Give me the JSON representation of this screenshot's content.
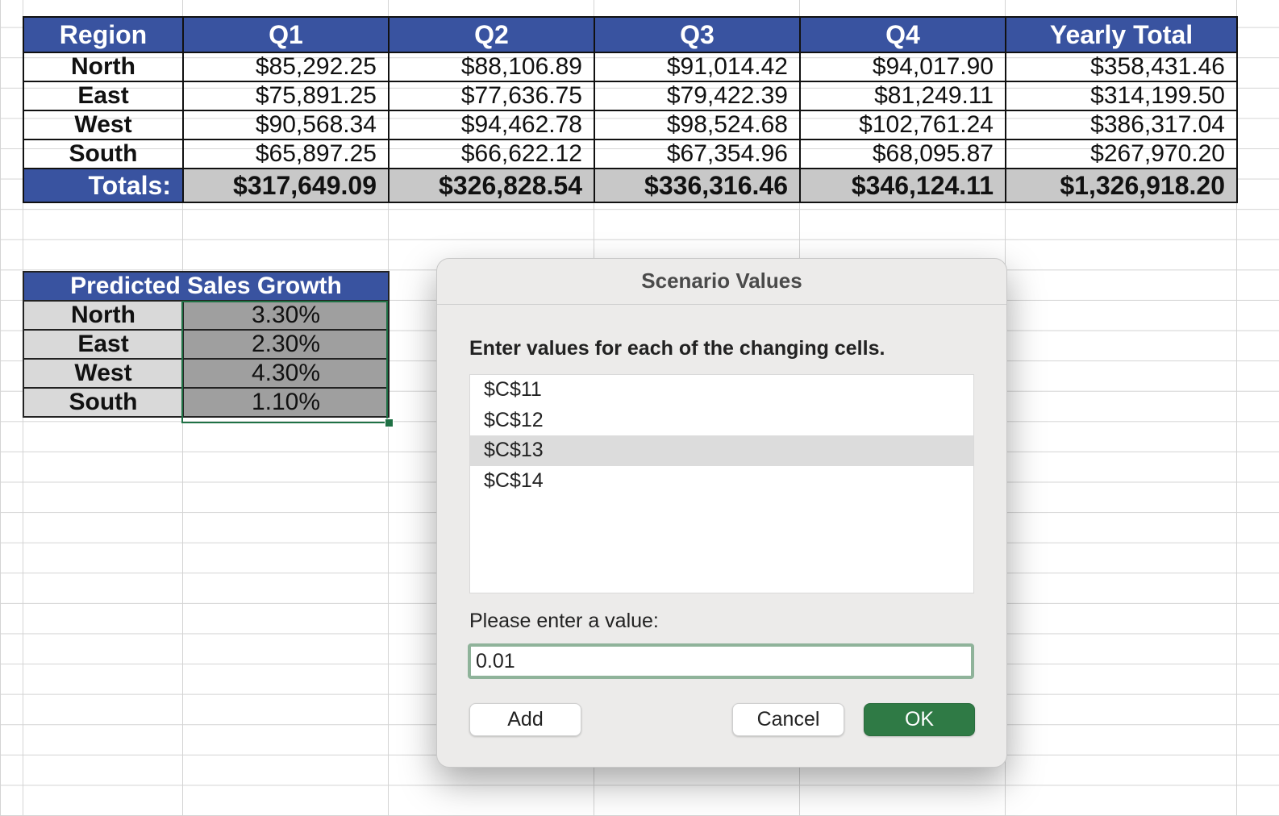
{
  "sales_table": {
    "headers": [
      "Region",
      "Q1",
      "Q2",
      "Q3",
      "Q4",
      "Yearly Total"
    ],
    "rows": [
      [
        "North",
        "$85,292.25",
        "$88,106.89",
        "$91,014.42",
        "$94,017.90",
        "$358,431.46"
      ],
      [
        "East",
        "$75,891.25",
        "$77,636.75",
        "$79,422.39",
        "$81,249.11",
        "$314,199.50"
      ],
      [
        "West",
        "$90,568.34",
        "$94,462.78",
        "$98,524.68",
        "$102,761.24",
        "$386,317.04"
      ],
      [
        "South",
        "$65,897.25",
        "$66,622.12",
        "$67,354.96",
        "$68,095.87",
        "$267,970.20"
      ]
    ],
    "totals": [
      "Totals:",
      "$317,649.09",
      "$326,828.54",
      "$336,316.46",
      "$346,124.11",
      "$1,326,918.20"
    ]
  },
  "growth_table": {
    "title": "Predicted Sales Growth",
    "rows": [
      [
        "North",
        "3.30%"
      ],
      [
        "East",
        "2.30%"
      ],
      [
        "West",
        "4.30%"
      ],
      [
        "South",
        "1.10%"
      ]
    ]
  },
  "dialog": {
    "title": "Scenario Values",
    "prompt": "Enter values for each of the changing cells.",
    "cells": [
      "$C$11",
      "$C$12",
      "$C$13",
      "$C$14"
    ],
    "selected_cell": "$C$13",
    "value_label": "Please enter a value:",
    "value": "0.01",
    "add_label": "Add",
    "cancel_label": "Cancel",
    "ok_label": "OK",
    "ok_color": "#2f7a45"
  },
  "colors": {
    "header_blue": "#3953a0",
    "selection_green": "#1f7145"
  }
}
